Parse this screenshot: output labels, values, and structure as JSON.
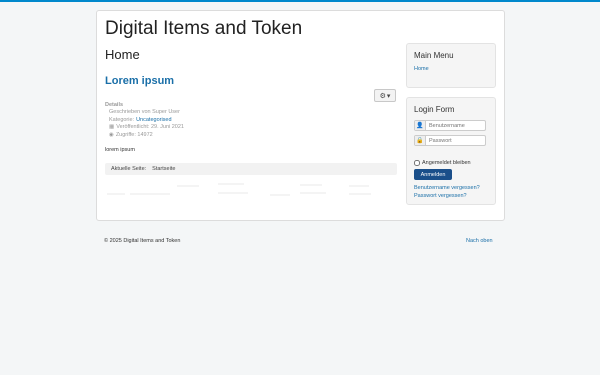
{
  "header": {
    "site_title": "Digital Items and Token"
  },
  "page": {
    "title": "Home"
  },
  "article": {
    "title": "Lorem ipsum",
    "details_label": "Details",
    "author": "Geschrieben von Super User",
    "category_label": "Kategorie:",
    "category_value": "Uncategorised",
    "published": "Veröffentlicht: 29. Juni 2021",
    "hits": "Zugriffe: 14972",
    "body": "lorem ipsum",
    "gear_icon": "gear-icon"
  },
  "breadcrumb": {
    "label": "Aktuelle Seite:",
    "current": "Startseite"
  },
  "main_menu": {
    "title": "Main Menu",
    "items": [
      "Home"
    ]
  },
  "login": {
    "title": "Login Form",
    "username_placeholder": "Benutzername",
    "password_placeholder": "Passwort",
    "remember_label": "Angemeldet bleiben",
    "submit_label": "Anmelden",
    "forgot_username": "Benutzername vergessen?",
    "forgot_password": "Passwort vergessen?"
  },
  "footer": {
    "copyright": "© 2025 Digital Items and Token",
    "back_to_top": "Nach oben"
  },
  "colors": {
    "accent": "#1a6fa8",
    "button": "#1a4f8a",
    "top_bar": "#0088cc"
  }
}
